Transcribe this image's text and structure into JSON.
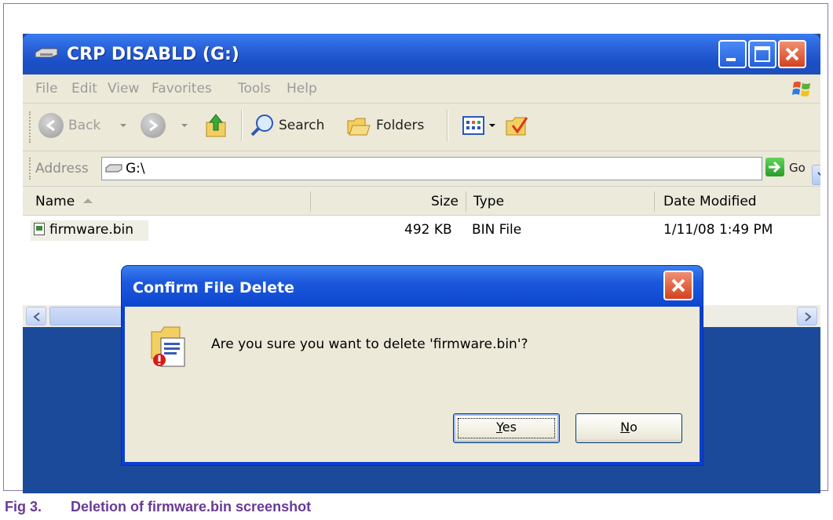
{
  "window": {
    "title": "CRP DISABLD (G:)",
    "menu": [
      "File",
      "Edit",
      "View",
      "Favorites",
      "Tools",
      "Help"
    ],
    "toolbar": {
      "back_label": "Back",
      "search_label": "Search",
      "folders_label": "Folders"
    },
    "address": {
      "label": "Address",
      "value": "G:\\",
      "go_label": "Go"
    },
    "columns": [
      "Name",
      "Size",
      "Type",
      "Date Modified"
    ],
    "files": [
      {
        "name": "firmware.bin",
        "size": "492 KB",
        "type": "BIN File",
        "date_modified": "1/11/08 1:49 PM"
      }
    ]
  },
  "dialog": {
    "title": "Confirm File Delete",
    "message": "Are you sure you want to delete 'firmware.bin'?",
    "yes_first": "Y",
    "yes_rest": "es",
    "no_first": "N",
    "no_rest": "o"
  },
  "caption": {
    "number": "Fig 3.",
    "text": "Deletion of firmware.bin screenshot"
  },
  "colors": {
    "title_blue": "#2a62d8",
    "chrome": "#ece9d8",
    "caption": "#6a3a96"
  },
  "icons": [
    "drive-icon",
    "minimize-icon",
    "maximize-icon",
    "close-icon",
    "xp-logo-icon",
    "back-icon",
    "forward-icon",
    "up-folder-icon",
    "search-icon",
    "folders-icon",
    "views-icon",
    "folder-sync-icon",
    "go-icon",
    "sort-asc-icon",
    "file-icon",
    "scroll-left-icon",
    "scroll-right-icon",
    "delete-file-warning-icon"
  ]
}
